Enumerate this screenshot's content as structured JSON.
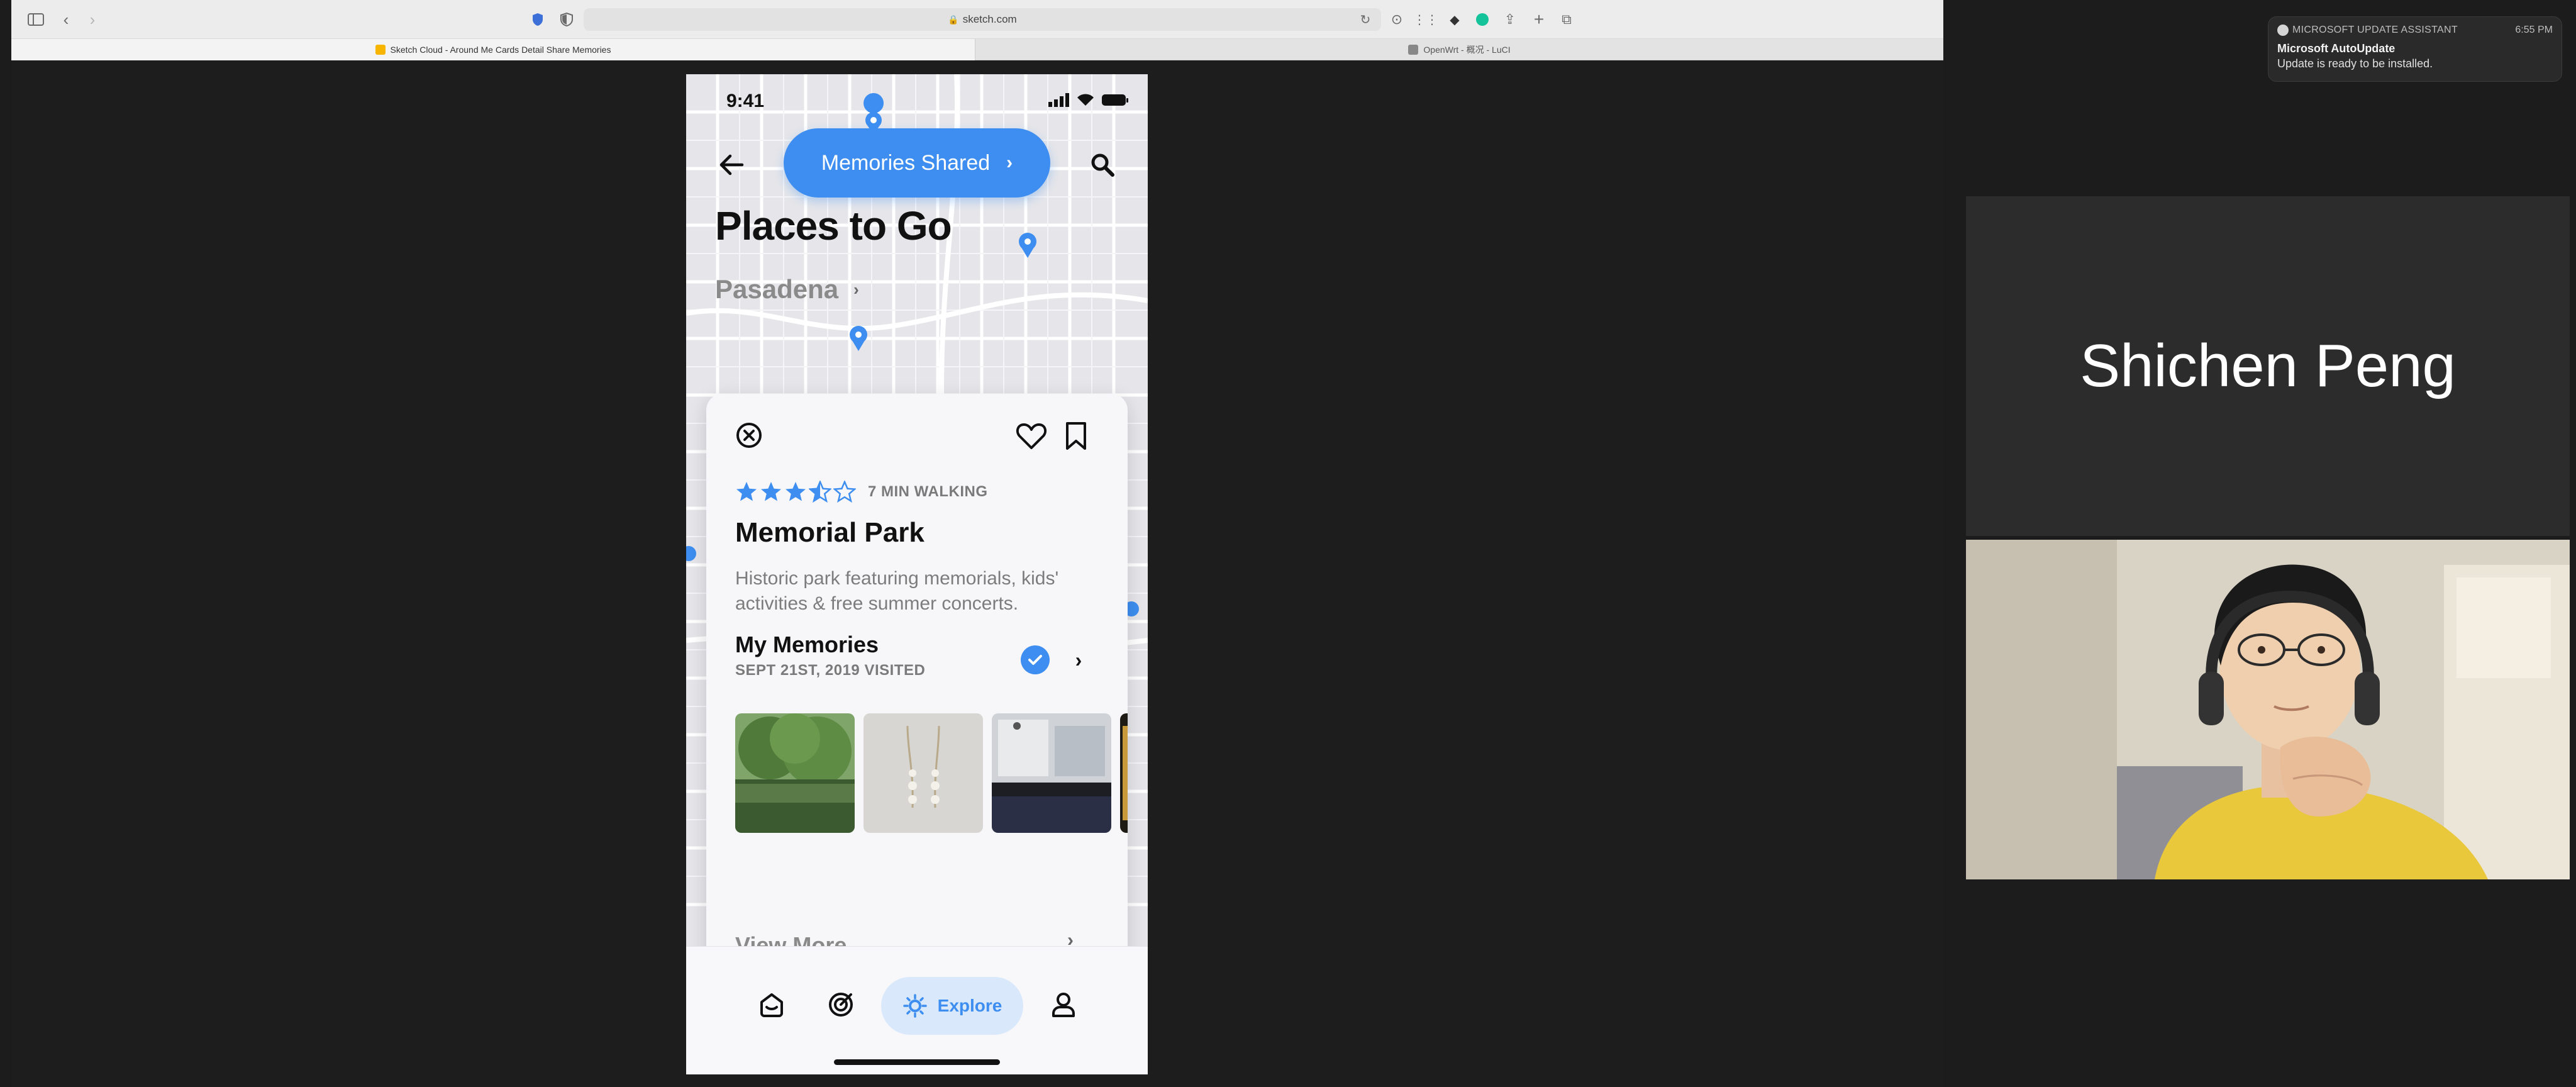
{
  "browser": {
    "url": "sketch.com",
    "tabs": [
      {
        "label": "Sketch Cloud - Around Me Cards Detail Share Memories"
      },
      {
        "label": "OpenWrt - 概况 - LuCI"
      }
    ]
  },
  "phone": {
    "status_time": "9:41",
    "memories_pill": "Memories Shared",
    "places_title": "Places to Go",
    "city": "Pasadena",
    "card": {
      "rating": 3.5,
      "walk_time": "7 MIN WALKING",
      "name": "Memorial Park",
      "description": "Historic park featuring memorials, kids' activities & free summer concerts.",
      "memories_title": "My Memories",
      "memories_date": "SEPT 21ST, 2019 VISITED",
      "view_more": "View More"
    },
    "tabbar": {
      "explore_label": "Explore"
    }
  },
  "notification": {
    "app": "MICROSOFT UPDATE ASSISTANT",
    "time": "6:55 PM",
    "title": "Microsoft AutoUpdate",
    "body": "Update is ready to be installed."
  },
  "participant": {
    "name": "Shichen Peng"
  },
  "colors": {
    "accent": "#3d8ef0",
    "pill_bg": "#d9e9fb"
  }
}
